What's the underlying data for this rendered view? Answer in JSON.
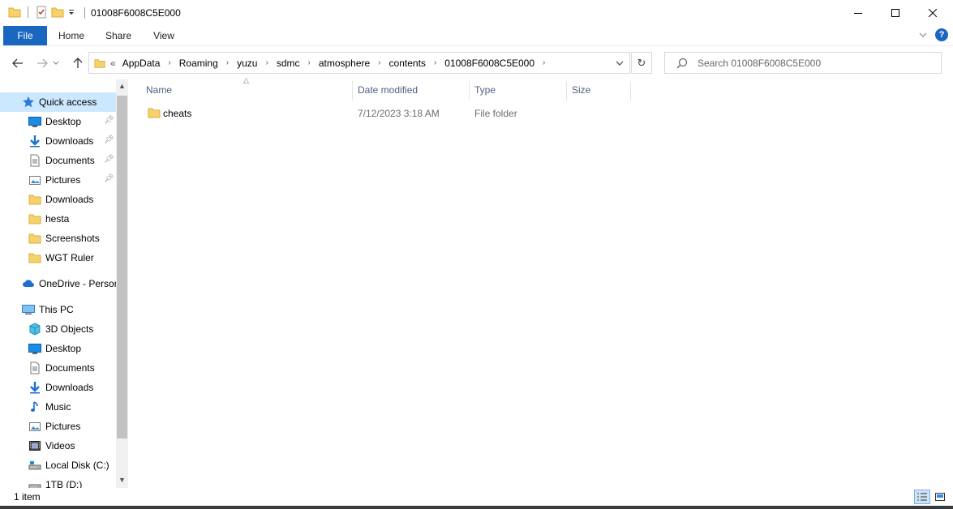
{
  "window": {
    "title": "01008F6008C5E000",
    "controls": [
      "minimize",
      "maximize",
      "close"
    ]
  },
  "ribbon": {
    "tabs": [
      {
        "label": "File"
      },
      {
        "label": "Home"
      },
      {
        "label": "Share"
      },
      {
        "label": "View"
      }
    ]
  },
  "address": {
    "overflow": "«",
    "segments": [
      "AppData",
      "Roaming",
      "yuzu",
      "sdmc",
      "atmosphere",
      "contents",
      "01008F6008C5E000"
    ]
  },
  "search": {
    "placeholder": "Search 01008F6008C5E000"
  },
  "sidebar": {
    "quick_access": {
      "label": "Quick access"
    },
    "quick_items": [
      {
        "label": "Desktop",
        "icon": "desktop-icon",
        "pinned": true
      },
      {
        "label": "Downloads",
        "icon": "download-icon",
        "pinned": true
      },
      {
        "label": "Documents",
        "icon": "document-icon",
        "pinned": true
      },
      {
        "label": "Pictures",
        "icon": "pictures-icon",
        "pinned": true
      },
      {
        "label": "Downloads",
        "icon": "folder-icon",
        "pinned": false
      },
      {
        "label": "hesta",
        "icon": "folder-icon",
        "pinned": false
      },
      {
        "label": "Screenshots",
        "icon": "folder-icon",
        "pinned": false
      },
      {
        "label": "WGT Ruler",
        "icon": "folder-icon",
        "pinned": false
      }
    ],
    "onedrive": {
      "label": "OneDrive - Persor"
    },
    "this_pc": {
      "label": "This PC"
    },
    "pc_items": [
      {
        "label": "3D Objects",
        "icon": "cube-icon"
      },
      {
        "label": "Desktop",
        "icon": "desktop-icon"
      },
      {
        "label": "Documents",
        "icon": "document-icon"
      },
      {
        "label": "Downloads",
        "icon": "download-icon"
      },
      {
        "label": "Music",
        "icon": "music-icon"
      },
      {
        "label": "Pictures",
        "icon": "pictures-icon"
      },
      {
        "label": "Videos",
        "icon": "video-icon"
      },
      {
        "label": "Local Disk (C:)",
        "icon": "drive-icon"
      },
      {
        "label": "1TB (D:)",
        "icon": "drive-icon"
      }
    ]
  },
  "columns": {
    "name": "Name",
    "date_modified": "Date modified",
    "type": "Type",
    "size": "Size"
  },
  "files": [
    {
      "name": "cheats",
      "date_modified": "7/12/2023 3:18 AM",
      "type": "File folder",
      "size": ""
    }
  ],
  "status": {
    "item_count": "1 item"
  },
  "colors": {
    "accent": "#1a67c0",
    "selection": "#cce8ff",
    "header_text": "#4d6082",
    "folder": "#f7d26b"
  }
}
